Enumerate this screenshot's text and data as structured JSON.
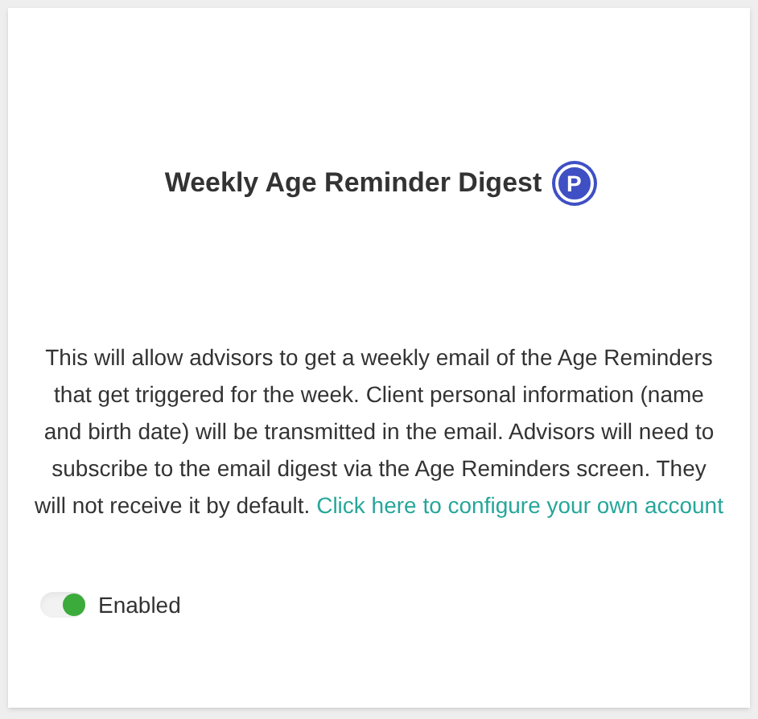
{
  "title": "Weekly Age Reminder Digest",
  "badge": "P",
  "description": "This will allow advisors to get a weekly email of the Age Reminders that get triggered for the week. Client personal information (name and birth date) will be transmitted in the email. Advisors will need to subscribe to the email digest via the Age Reminders screen. They will not receive it by default.",
  "link": "Click here to configure your own account",
  "toggle": {
    "label": "Enabled",
    "on": true
  }
}
